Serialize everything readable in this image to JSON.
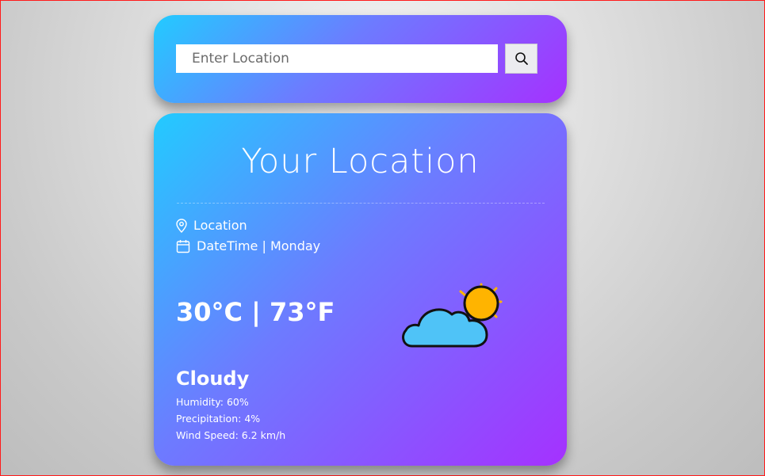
{
  "search": {
    "placeholder": "Enter Location",
    "button_icon": "search-icon"
  },
  "weather": {
    "title": "Your Location",
    "location_label": "Location",
    "location_icon": "map-pin-icon",
    "datetime_label": "DateTime | Monday",
    "datetime_icon": "calendar-icon",
    "temperature": "30°C | 73°F",
    "condition": "Cloudy",
    "condition_icon": "partly-cloudy-icon",
    "humidity": "Humidity: 60%",
    "precipitation": "Precipitation: 4%",
    "wind_speed": "Wind Speed: 6.2 km/h"
  },
  "colors": {
    "gradient_start": "#22cbff",
    "gradient_end": "#a531ff",
    "sun": "#ffb400",
    "cloud": "#4fc3f7"
  }
}
